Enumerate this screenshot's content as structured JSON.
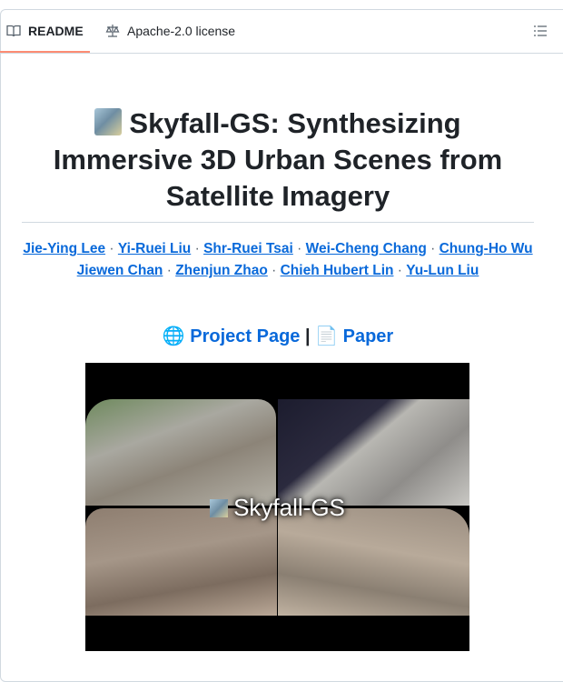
{
  "tabs": {
    "readme": "README",
    "license": "Apache-2.0 license"
  },
  "title": "Skyfall-GS: Synthesizing Immersive 3D Urban Scenes from Satellite Imagery",
  "authors": [
    "Jie-Ying Lee",
    "Yi-Ruei Liu",
    "Shr-Ruei Tsai",
    "Wei-Cheng Chang",
    "Chung-Ho Wu",
    "Jiewen Chan",
    "Zhenjun Zhao",
    "Chieh Hubert Lin",
    "Yu-Lun Liu"
  ],
  "separator": "·",
  "links": {
    "project_icon": "🌐",
    "project": "Project Page",
    "divider": "|",
    "paper_icon": "📄",
    "paper": "Paper"
  },
  "video": {
    "overlay_title": "Skyfall-GS"
  },
  "colors": {
    "link": "#0969da",
    "tab_underline": "#fd8c73"
  }
}
